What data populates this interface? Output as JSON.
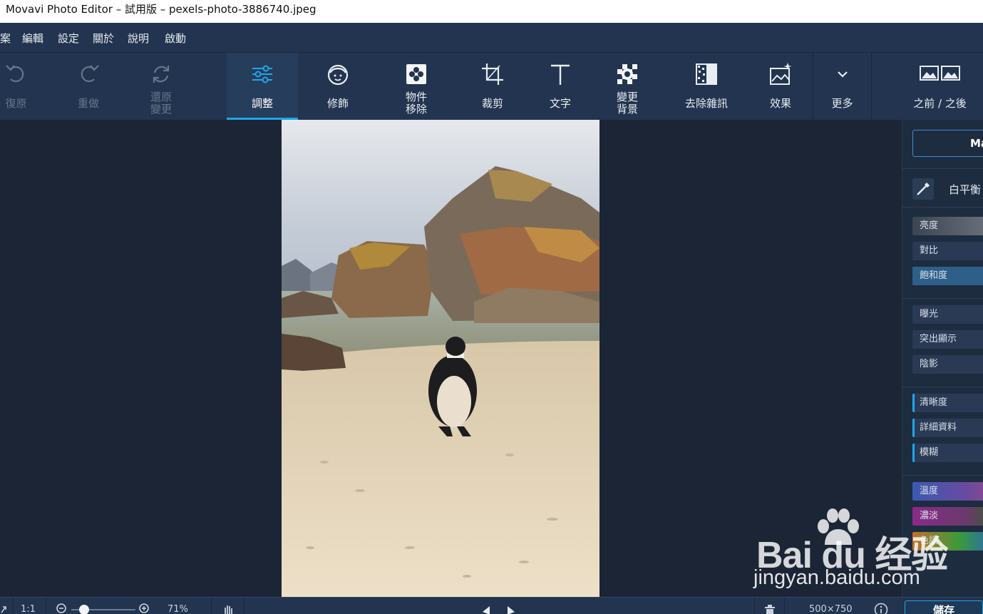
{
  "window": {
    "title": "Movavi Photo Editor – 試用版 – pexels-photo-3886740.jpeg"
  },
  "menu": [
    "案",
    "編輯",
    "設定",
    "關於",
    "說明",
    "啟動"
  ],
  "toolbar": {
    "undo": "復原",
    "redo": "重做",
    "revert_line1": "還原",
    "revert_line2": "變更",
    "adjust": "調整",
    "retouch": "修飾",
    "object_removal_line1": "物件",
    "object_removal_line2": "移除",
    "crop": "裁剪",
    "text": "文字",
    "change_bg_line1": "變更",
    "change_bg_line2": "背景",
    "denoise": "去除雜訊",
    "effects": "效果",
    "more": "更多",
    "before_after": "之前 / 之後"
  },
  "panel": {
    "magic_label": "Ma",
    "white_balance": "白平衡",
    "groups": [
      [
        {
          "label": "亮度",
          "color": "#6b727c"
        },
        {
          "label": "對比",
          "color": "#2a3a55"
        },
        {
          "label": "飽和度",
          "color": "#2d5f88"
        }
      ],
      [
        {
          "label": "曝光",
          "color": "#2a3a55"
        },
        {
          "label": "突出顯示",
          "color": "#2a3a55"
        },
        {
          "label": "陰影",
          "color": "#2a3a55"
        }
      ],
      [
        {
          "label": "清晰度",
          "color": "#2a3a55"
        },
        {
          "label": "詳細資料",
          "color": "#2a3a55"
        },
        {
          "label": "模糊",
          "color": "#2a3a55"
        }
      ],
      [
        {
          "label": "溫度",
          "color": "#3d58a8"
        },
        {
          "label": "濃淡",
          "color": "#8a2a8a"
        },
        {
          "label": "色調",
          "color": "#b8682a"
        }
      ]
    ]
  },
  "bottombar": {
    "ratio": "1:1",
    "zoom": "71%",
    "size": "500×750",
    "save": "儲存"
  },
  "watermark": {
    "logo": "Bai du 经验",
    "url": "jingyan.baidu.com"
  }
}
